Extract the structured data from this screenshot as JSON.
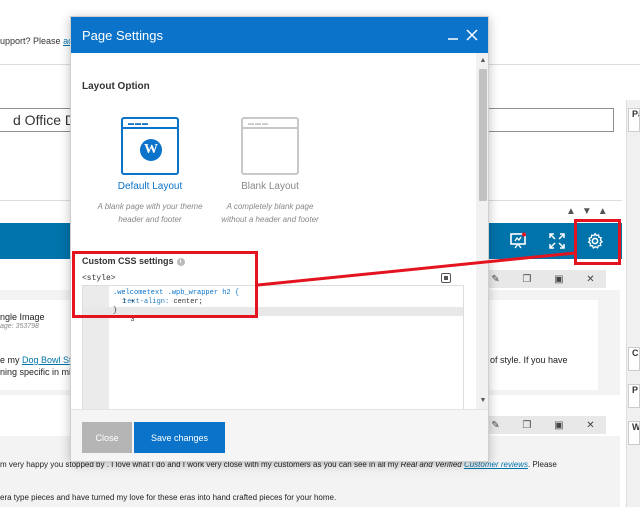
{
  "background": {
    "notice_text": "upport? Please",
    "notice_link": "actio",
    "title_value": "d Office Do",
    "single_image_label": "ngle Image",
    "image_id": "age: 353798",
    "body_text_1_prefix": "e my",
    "body_text_1_link": "Dog Bowl Sta",
    "body_text_1_right": "of style.  If you have",
    "body_text_2": "ning specific in mi",
    "body_text_3": "m very happy you stopped by .  I love what I do and I work very close with my customers as you can see in all my",
    "body_text_3_italic": "Real and Verified",
    "body_text_3_reviews": "Customer reviews",
    "body_text_3_end": ".  Please",
    "body_text_4": "era type pieces and have turned my love for these eras into hand crafted pieces for your home.",
    "right_boxes": [
      "Pa",
      "C",
      "P",
      "W"
    ],
    "accent": "#0073aa"
  },
  "modal": {
    "title": "Page Settings",
    "minimize_icon": "minimize-icon",
    "close_icon": "close-icon",
    "layout_option_label": "Layout Option",
    "layouts": [
      {
        "name": "Default Layout",
        "description": "A blank page with your theme header and footer",
        "selected": true
      },
      {
        "name": "Blank Layout",
        "description": "A completely blank page without a header and footer",
        "selected": false
      }
    ],
    "css_label": "Custom CSS settings",
    "style_tag": "<style>",
    "code_lines": [
      {
        "num": "1",
        "marker": "▾",
        "selector": ".welcometext .wpb_wrapper h2 {"
      },
      {
        "num": "2",
        "property": "text-align:",
        "value": " center;"
      },
      {
        "num": "3",
        "closing": "}"
      }
    ],
    "close_button": "Close",
    "save_button": "Save changes",
    "header_color": "#0b73c9"
  },
  "annotation_color": "#e3141f"
}
